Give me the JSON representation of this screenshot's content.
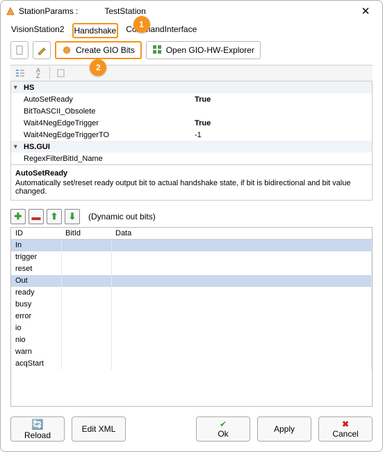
{
  "window": {
    "title_prefix": "StationParams :",
    "title_suffix": "TestStation",
    "close": "✕"
  },
  "tabs": {
    "t0": "VisionStation2",
    "t1": "Handshake",
    "t2": "CommandInterface",
    "badge1": "1"
  },
  "toolbar": {
    "create_gio": "Create GIO Bits",
    "open_explorer": "Open GIO-HW-Explorer",
    "badge2": "2"
  },
  "grid": {
    "cat_hs": "HS",
    "hs": {
      "auto_set_ready": {
        "label": "AutoSetReady",
        "value": "True"
      },
      "bit_to_ascii": {
        "label": "BitToASCII_Obsolete",
        "value": ""
      },
      "wait_neg": {
        "label": "Wait4NegEdgeTrigger",
        "value": "True"
      },
      "wait_neg_to": {
        "label": "Wait4NegEdgeTriggerTO",
        "value": "-1"
      }
    },
    "cat_gui": "HS.GUI",
    "gui": {
      "regex": {
        "label": "RegexFilterBitId_Name",
        "value": ""
      }
    }
  },
  "help": {
    "title": "AutoSetReady",
    "text": "Automatically set/reset ready output bit to actual handshake state, if bit is bidirectional and bit value changed."
  },
  "dyn": {
    "label": "(Dynamic out bits)",
    "headers": {
      "id": "ID",
      "bitid": "BitId",
      "data": "Data"
    },
    "rows": [
      {
        "id": "In",
        "sel": true
      },
      {
        "id": "trigger"
      },
      {
        "id": "reset"
      },
      {
        "id": "Out",
        "sel": true
      },
      {
        "id": "ready"
      },
      {
        "id": "busy"
      },
      {
        "id": "error"
      },
      {
        "id": "io"
      },
      {
        "id": "nio"
      },
      {
        "id": "warn"
      },
      {
        "id": "acqStart"
      }
    ]
  },
  "footer": {
    "reload": "Reload",
    "edit_xml": "Edit XML",
    "ok": "Ok",
    "apply": "Apply",
    "cancel": "Cancel"
  }
}
